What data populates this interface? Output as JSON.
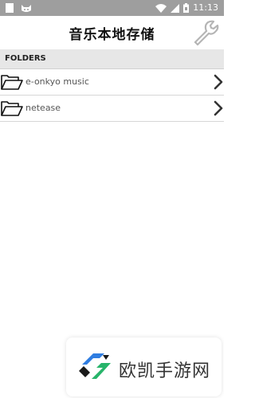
{
  "status_bar": {
    "time": "11:13",
    "icons": [
      "notification-square-icon",
      "cat-app-icon",
      "wifi-icon",
      "signal-icon",
      "battery-icon"
    ]
  },
  "header": {
    "title": "音乐本地存储",
    "settings_icon": "wrench-icon"
  },
  "section": {
    "title": "FOLDERS"
  },
  "folders": [
    {
      "name": "e-onkyo music",
      "icon": "folder-open-icon"
    },
    {
      "name": "netease",
      "icon": "folder-open-icon"
    }
  ],
  "watermark": {
    "text": "欧凯手游网",
    "colors": {
      "blue": "#2f7de1",
      "green": "#27b46a",
      "black": "#1a1a1a"
    }
  }
}
